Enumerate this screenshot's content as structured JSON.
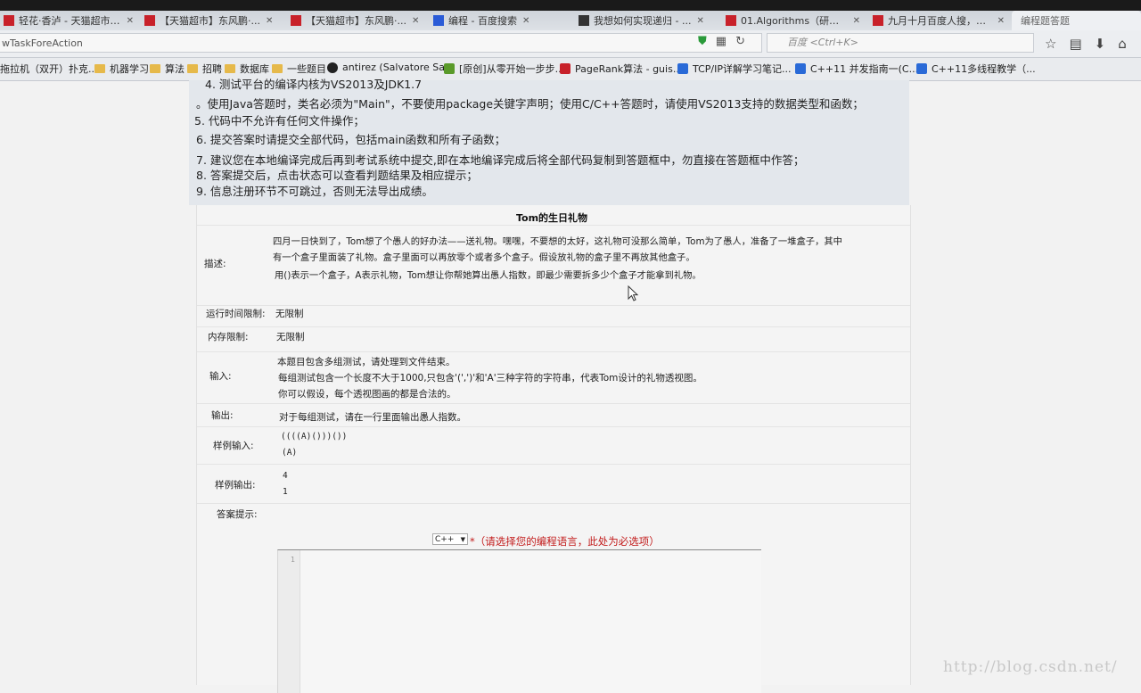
{
  "tabs": [
    {
      "label": "轻花·香泸 - 天猫超市 - ...",
      "color": "#c8212a"
    },
    {
      "label": "【天猫超市】东风鹏·...",
      "color": "#c8212a"
    },
    {
      "label": "【天猫超市】东风鹏·...",
      "color": "#c8212a"
    },
    {
      "label": "编程 - 百度搜索",
      "color": "#2a5bd7"
    },
    {
      "label": "我想如何实现递归 - ...",
      "color": "#333333"
    },
    {
      "label": "01.Algorithms（研究...",
      "color": "#c8212a"
    },
    {
      "label": "九月十月百度人搜，阿...",
      "color": "#c8212a"
    },
    {
      "label": "编程题答题",
      "color": "#888888"
    }
  ],
  "url": {
    "value": "wTaskForeAction"
  },
  "search": {
    "placeholder": "百度 <Ctrl+K>"
  },
  "bookmarks": [
    {
      "label": "拖拉机（双开）扑克...",
      "icon": "red-square"
    },
    {
      "label": "机器学习",
      "icon": "folder"
    },
    {
      "label": "算法",
      "icon": "folder"
    },
    {
      "label": "招聘",
      "icon": "folder"
    },
    {
      "label": "数据库",
      "icon": "folder"
    },
    {
      "label": "一些题目",
      "icon": "folder"
    },
    {
      "label": "antirez (Salvatore Sa...",
      "icon": "github"
    },
    {
      "label": "[原创]从零开始一步步...",
      "icon": "green-square"
    },
    {
      "label": "PageRank算法 - guis...",
      "icon": "csdn"
    },
    {
      "label": "TCP/IP详解学习笔记...",
      "icon": "blue-square"
    },
    {
      "label": "C++11 并发指南一(C...",
      "icon": "blue-square"
    },
    {
      "label": "C++11多线程教学（...",
      "icon": "blue-square"
    }
  ],
  "notice": [
    "4. 测试平台的编译内核为VS2013及JDK1.7",
    "。使用Java答题时，类名必须为\"Main\"，不要使用package关键字声明；使用C/C++答题时，请使用VS2013支持的数据类型和函数；",
    "5. 代码中不允许有任何文件操作；",
    "6. 提交答案时请提交全部代码，包括main函数和所有子函数；",
    "7. 建议您在本地编译完成后再到考试系统中提交,即在本地编译完成后将全部代码复制到答题框中，勿直接在答题框中作答；",
    "8. 答案提交后，点击状态可以查看判题结果及相应提示；",
    "9. 信息注册环节不可跳过，否则无法导出成绩。"
  ],
  "problem": {
    "title": "Tom的生日礼物",
    "desc_label": "描述:",
    "desc_lines": [
      "四月一日快到了，Tom想了个愚人的好办法——送礼物。嘿嘿，不要想的太好，这礼物可没那么简单，Tom为了愚人，准备了一堆盒子，其中",
      "有一个盒子里面装了礼物。盒子里面可以再放零个或者多个盒子。假设放礼物的盒子里不再放其他盒子。",
      "用()表示一个盒子，A表示礼物，Tom想让你帮她算出愚人指数，即最少需要拆多少个盒子才能拿到礼物。"
    ],
    "time_label": "运行时间限制:",
    "time_value": "无限制",
    "mem_label": "内存限制:",
    "mem_value": "无限制",
    "input_label": "输入:",
    "input_lines": [
      "本题目包含多组测试，请处理到文件结束。",
      "每组测试包含一个长度不大于1000,只包含'(',')'和'A'三种字符的字符串，代表Tom设计的礼物透视图。",
      "你可以假设，每个透视图画的都是合法的。"
    ],
    "output_label": "输出:",
    "output_value": "对于每组测试，请在一行里面输出愚人指数。",
    "sample_in_label": "样例输入:",
    "sample_in": [
      "((((A)()))())",
      "(A)"
    ],
    "sample_out_label": "样例输出:",
    "sample_out": [
      "4",
      "1"
    ],
    "hint_label": "答案提示:"
  },
  "editor": {
    "language": "C++",
    "required_note": "*（请选择您的编程语言，此处为必选项）",
    "line_number": "1"
  },
  "watermark": "http://blog.csdn.net/"
}
